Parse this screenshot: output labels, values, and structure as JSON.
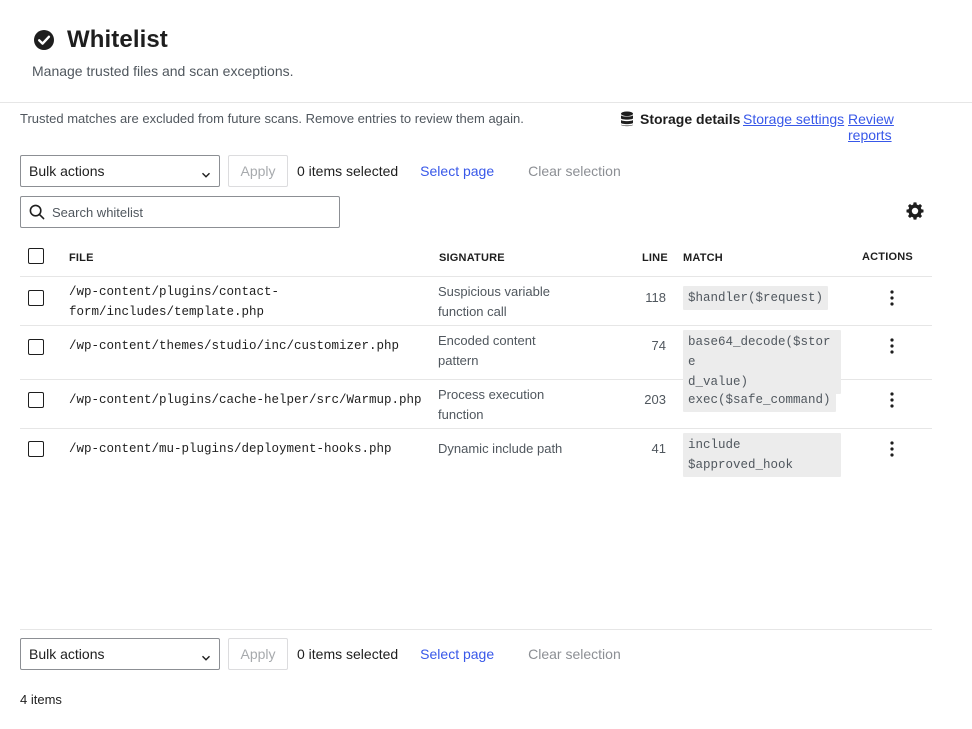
{
  "header": {
    "title": "Whitelist",
    "subtitle": "Manage trusted files and scan exceptions.",
    "title_icon": "check-circle-icon"
  },
  "info": {
    "text": "Trusted matches are excluded from future scans. Remove entries to review them again.",
    "storage_details": "Storage details",
    "storage_settings": "Storage settings",
    "review_reports": "Review reports"
  },
  "bulk": {
    "select_value": "Bulk actions",
    "apply": "Apply",
    "items_selected": "0 items selected",
    "select_page": "Select page",
    "clear_selection": "Clear selection"
  },
  "search": {
    "placeholder": "Search whitelist",
    "value": ""
  },
  "table": {
    "columns": {
      "file": "FILE",
      "signature": "SIGNATURE",
      "line": "LINE",
      "match": "MATCH",
      "actions": "ACTIONS"
    },
    "rows": [
      {
        "file_1": "/wp-content/plugins/contact-",
        "file_2": "form/includes/template.php",
        "sig_1": "Suspicious variable",
        "sig_2": "function call",
        "line": "118",
        "match_1": "$handler($request)",
        "match_2": ""
      },
      {
        "file_1": "/wp-content/themes/studio/inc/customizer.php",
        "file_2": "",
        "sig_1": "Encoded content",
        "sig_2": "pattern",
        "line": "74",
        "match_1": "base64_decode($store",
        "match_2": "d_value)"
      },
      {
        "file_1": "/wp-content/plugins/cache-helper/src/Warmup.php",
        "file_2": "",
        "sig_1": "Process execution",
        "sig_2": "function",
        "line": "203",
        "match_1": "exec($safe_command)",
        "match_2": ""
      },
      {
        "file_1": "/wp-content/mu-plugins/deployment-hooks.php",
        "file_2": "",
        "sig_1": "Dynamic include path",
        "sig_2": "",
        "line": "41",
        "match_1": "include",
        "match_2": "$approved_hook"
      }
    ]
  },
  "footer": {
    "item_count": "4 items"
  },
  "colors": {
    "accent": "#3858e9",
    "text": "#1e1e1e",
    "muted": "#50575e",
    "code_bg": "#ececec",
    "disabled": "#a7aaad",
    "border": "#e6e6e6"
  }
}
